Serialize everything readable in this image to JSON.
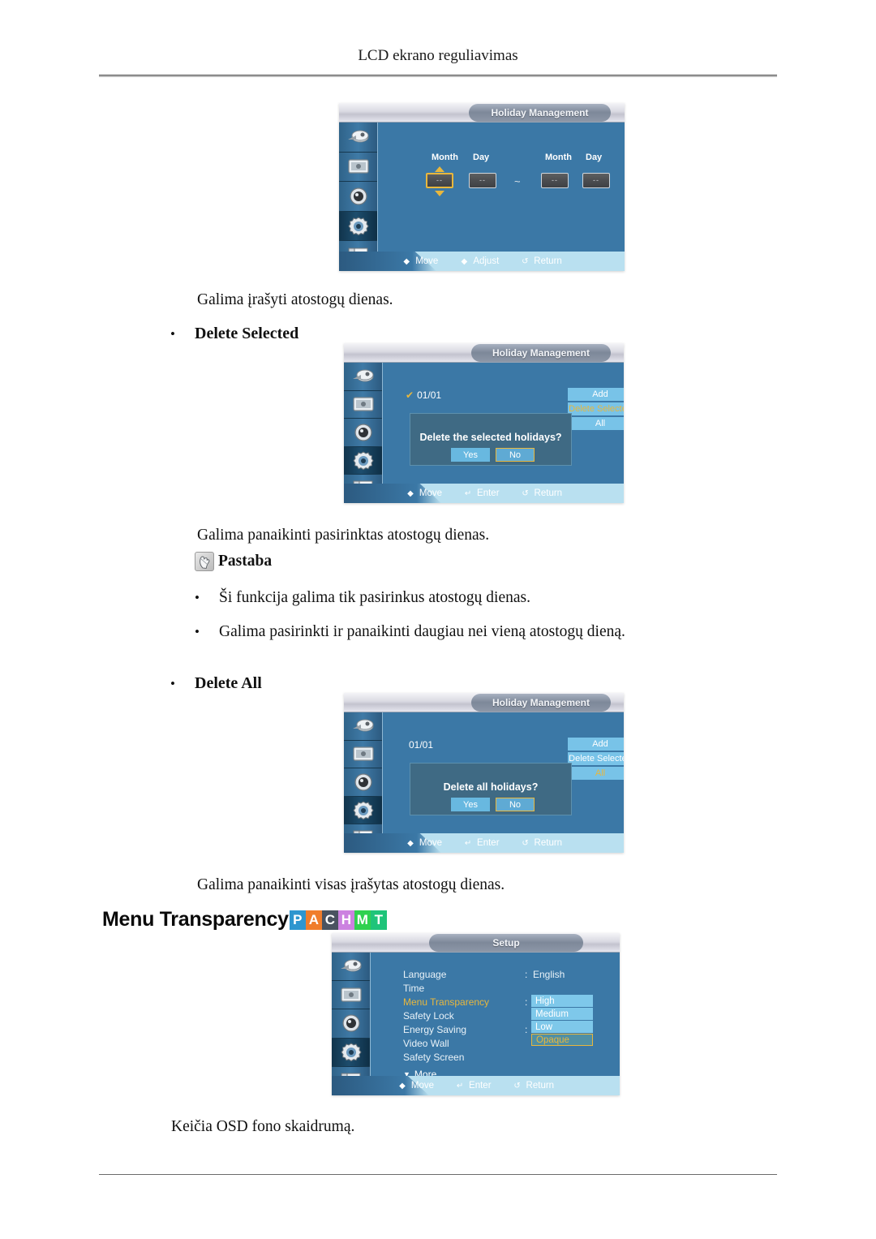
{
  "header": {
    "title": "LCD ekrano reguliavimas"
  },
  "paragraphs": {
    "after_first_osd": "Galima įrašyti atostogų dienas.",
    "after_second_osd": "Galima panaikinti pasirinktas atostogų dienas.",
    "after_third_osd": "Galima panaikinti visas įrašytas atostogų dienas.",
    "after_fourth_osd": "Keičia OSD fono skaidrumą."
  },
  "bullets": {
    "delete_selected": "Delete Selected",
    "delete_all": "Delete All"
  },
  "note": {
    "icon": "note-hand-icon",
    "label": "Pastaba",
    "items": [
      "Ši funkcija galima tik pasirinkus atostogų dienas.",
      "Galima pasirinkti ir panaikinti daugiau nei vieną atostogų dieną."
    ]
  },
  "section": {
    "heading": "Menu Transparency",
    "badges": [
      {
        "letter": "P",
        "color": "#2e96cf"
      },
      {
        "letter": "A",
        "color": "#f07d2b"
      },
      {
        "letter": "C",
        "color": "#4a5360"
      },
      {
        "letter": "H",
        "color": "#cc82e0"
      },
      {
        "letter": "M",
        "color": "#2fd14f"
      },
      {
        "letter": "T",
        "color": "#1fc47a"
      }
    ]
  },
  "osd_common": {
    "sidebar_icons": [
      "input-source-icon",
      "picture-icon",
      "sound-speaker-icon",
      "setup-gear-icon",
      "multi-control-icon"
    ],
    "active_icon_index": 3,
    "hints_move_adjust_return": [
      {
        "glyph": "◆",
        "label": "Move",
        "icon": "move-icon"
      },
      {
        "glyph": "◆",
        "label": "Adjust",
        "icon": "adjust-icon"
      },
      {
        "glyph": "↺",
        "label": "Return",
        "icon": "return-icon"
      }
    ],
    "hints_move_enter_return": [
      {
        "glyph": "◆",
        "label": "Move",
        "icon": "move-icon"
      },
      {
        "glyph": "↵",
        "label": "Enter",
        "icon": "enter-icon"
      },
      {
        "glyph": "↺",
        "label": "Return",
        "icon": "return-icon"
      }
    ]
  },
  "osd1": {
    "title": "Holiday Management",
    "labels": {
      "month1": "Month",
      "day1": "Day",
      "month2": "Month",
      "day2": "Day"
    },
    "fields": {
      "month1": "--",
      "day1": "--",
      "separator": "~",
      "month2": "--",
      "day2": "--"
    },
    "selected_field": "month1"
  },
  "osd2": {
    "title": "Holiday Management",
    "entry": {
      "check": "✔",
      "date": "01/01"
    },
    "buttons": [
      {
        "label": "Add",
        "highlighted": false
      },
      {
        "label": "Delete Selected",
        "highlighted": true
      },
      {
        "label": "All",
        "highlighted": false
      }
    ],
    "dialog": {
      "message": "Delete the selected holidays?",
      "yes": "Yes",
      "no": "No",
      "focused": "No"
    }
  },
  "osd3": {
    "title": "Holiday Management",
    "entry": {
      "check": "",
      "date": "01/01"
    },
    "buttons": [
      {
        "label": "Add",
        "highlighted": false
      },
      {
        "label": "Delete Selected",
        "highlighted": false
      },
      {
        "label": "All",
        "highlighted": true
      }
    ],
    "dialog": {
      "message": "Delete all holidays?",
      "yes": "Yes",
      "no": "No",
      "focused": "No"
    }
  },
  "osd4": {
    "title": "Setup",
    "rows": [
      {
        "label": "Language",
        "colon": ":",
        "value": "English",
        "active": false
      },
      {
        "label": "Time",
        "colon": "",
        "value": "",
        "active": false
      },
      {
        "label": "Menu Transparency",
        "colon": ":",
        "value": "",
        "active": true
      },
      {
        "label": "Safety Lock",
        "colon": "",
        "value": "",
        "active": false
      },
      {
        "label": "Energy Saving",
        "colon": ":",
        "value": "",
        "active": false
      },
      {
        "label": "Video Wall",
        "colon": "",
        "value": "",
        "active": false
      },
      {
        "label": "Safety Screen",
        "colon": "",
        "value": "",
        "active": false
      }
    ],
    "more": {
      "glyph": "▼",
      "label": "More"
    },
    "dropdown": {
      "options": [
        "High",
        "Medium",
        "Low",
        "Opaque"
      ],
      "selected": "Opaque"
    }
  }
}
